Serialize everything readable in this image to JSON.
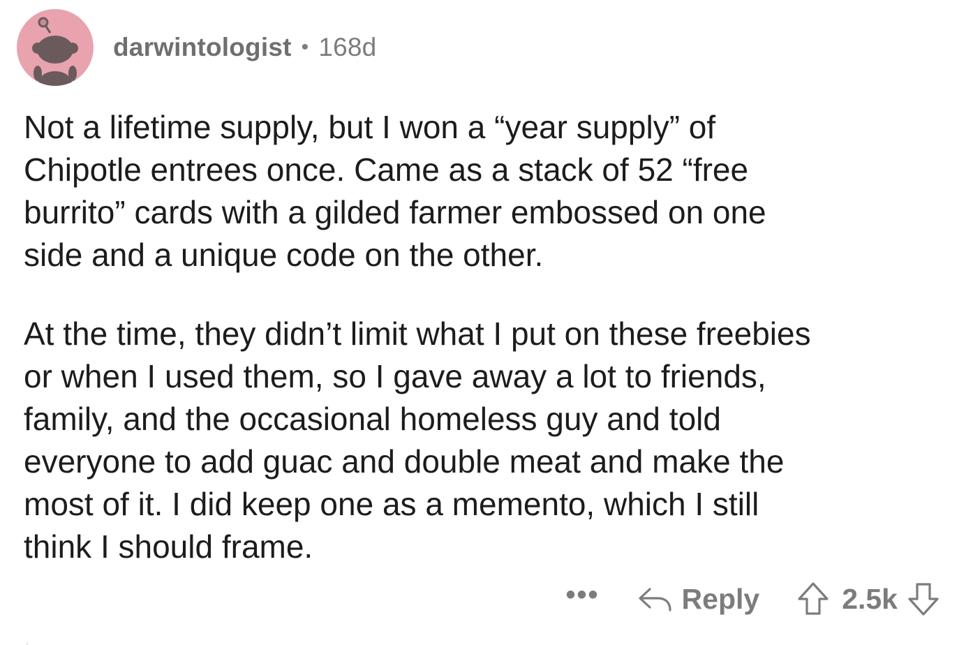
{
  "comment": {
    "author": "darwintologist",
    "separator": "•",
    "age": "168d",
    "paragraphs": [
      "Not a lifetime supply, but I won a “year supply” of\nChipotle entrees once. Came as a stack of 52 “free\nburrito” cards with a gilded farmer embossed on one\nside and a unique code on the other.",
      "At the time, they didn’t limit what I put on these freebies\nor when I used them, so I gave away a lot to friends,\nfamily, and the occasional homeless guy and told\neveryone to add guac and double meat and make the\nmost of it. I did keep one as a memento, which I still\nthink I should frame."
    ]
  },
  "actions": {
    "more_label": "•••",
    "reply_label": "Reply",
    "score": "2.5k"
  },
  "icons": {
    "avatar": "snoo-avatar",
    "reply": "reply-arrow-icon",
    "upvote": "upvote-arrow-icon",
    "downvote": "downvote-arrow-icon"
  },
  "colors": {
    "avatar_background": "#e8a3ae",
    "meta_text": "#7c7c7c",
    "body_text": "#1c1c1c"
  }
}
